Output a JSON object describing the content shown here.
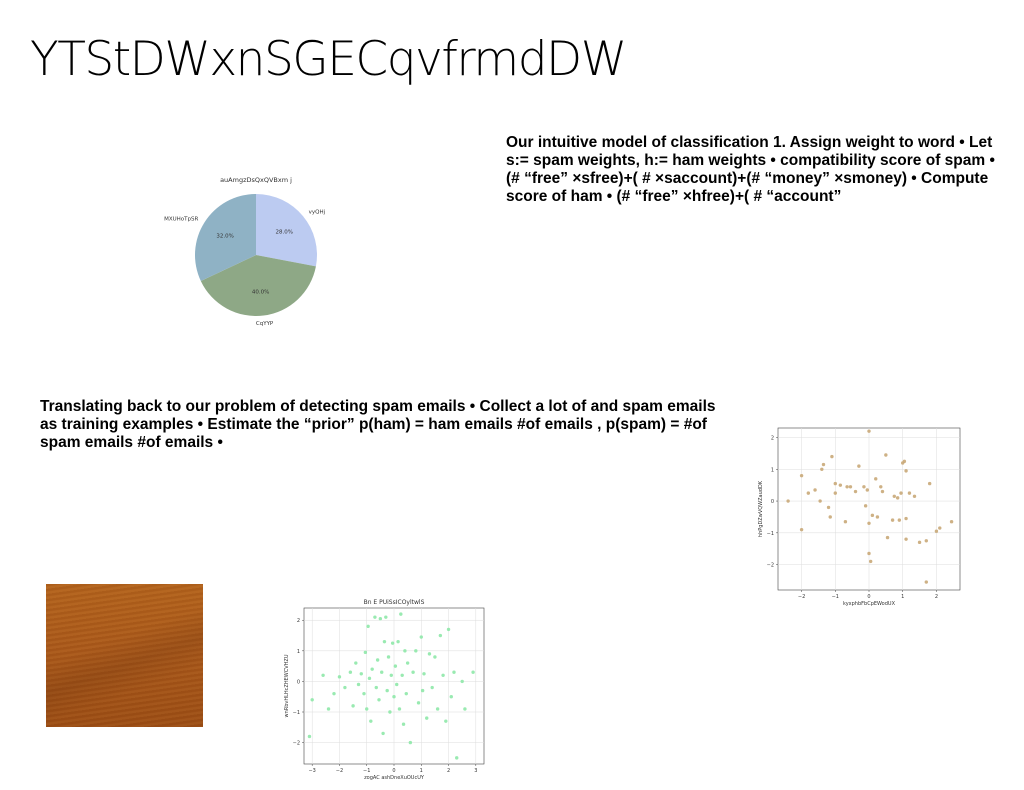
{
  "slide": {
    "title": "YTStDWxnSGECqvfrmdDW",
    "text_block_1": "Our intuitive model of classification 1. Assign weight to word • Let s:= spam weights, h:= ham weights • compatibility score of spam • (# “free” ×sfree)+( # ×saccount)+(# “money” ×smoney) • Compute score of ham • (# “free” ×hfree)+( # “account”",
    "text_block_2": "Translating back to our problem of detecting spam emails • Collect a lot of and spam emails as training examples • Estimate the “prior” p(ham) = ham emails #of emails , p(spam) = #of spam emails #of emails •",
    "image_description_icon": "wood-texture-image"
  },
  "chart_data": [
    {
      "type": "pie",
      "title": "auAmgzDsQxQVBxm j",
      "labels": [
        "vyQHj",
        "CqYYP",
        "MXUHoTpSR"
      ],
      "values": [
        28.0,
        40.0,
        32.0
      ],
      "pct_labels": [
        "28.0%",
        "40.0%",
        "32.0%"
      ],
      "colors": [
        "#bccbf1",
        "#8ea886",
        "#8fb2c5"
      ]
    },
    {
      "type": "scatter",
      "title": "",
      "xlabel": "kyxphbFbCpEWodUX",
      "ylabel": "hhPgDZwVQWZaudDK",
      "xlim": [
        -2.7,
        2.7
      ],
      "ylim": [
        -2.8,
        2.3
      ],
      "xticks": [
        -2,
        -1,
        0,
        1,
        2
      ],
      "yticks": [
        -2,
        -1,
        0,
        1,
        2
      ],
      "grid": true,
      "color": "#c9a978",
      "points": [
        [
          -2.4,
          0.0
        ],
        [
          -2.0,
          0.8
        ],
        [
          -2.0,
          -0.9
        ],
        [
          -1.8,
          0.25
        ],
        [
          -1.6,
          0.35
        ],
        [
          -1.45,
          0.0
        ],
        [
          -1.4,
          1.0
        ],
        [
          -1.35,
          1.15
        ],
        [
          -1.2,
          -0.2
        ],
        [
          -1.15,
          -0.5
        ],
        [
          -1.1,
          1.4
        ],
        [
          -1.0,
          0.25
        ],
        [
          -1.0,
          0.55
        ],
        [
          -0.85,
          0.5
        ],
        [
          -0.7,
          -0.65
        ],
        [
          -0.65,
          0.45
        ],
        [
          -0.55,
          0.45
        ],
        [
          -0.4,
          0.3
        ],
        [
          -0.3,
          1.1
        ],
        [
          -0.15,
          0.45
        ],
        [
          -0.1,
          -0.15
        ],
        [
          -0.05,
          0.35
        ],
        [
          0.0,
          2.2
        ],
        [
          0.0,
          -1.65
        ],
        [
          0.0,
          -0.7
        ],
        [
          0.05,
          -1.9
        ],
        [
          0.1,
          -0.45
        ],
        [
          0.2,
          0.7
        ],
        [
          0.25,
          -0.5
        ],
        [
          0.35,
          0.45
        ],
        [
          0.4,
          0.3
        ],
        [
          0.5,
          1.45
        ],
        [
          0.55,
          -1.15
        ],
        [
          0.7,
          -0.6
        ],
        [
          0.75,
          0.15
        ],
        [
          0.85,
          0.1
        ],
        [
          0.9,
          -0.6
        ],
        [
          0.95,
          0.25
        ],
        [
          1.0,
          1.2
        ],
        [
          1.05,
          1.25
        ],
        [
          1.1,
          0.95
        ],
        [
          1.1,
          -1.2
        ],
        [
          1.1,
          -0.55
        ],
        [
          1.2,
          0.25
        ],
        [
          1.35,
          0.15
        ],
        [
          1.5,
          -1.3
        ],
        [
          1.7,
          -2.55
        ],
        [
          1.7,
          -1.25
        ],
        [
          1.8,
          0.55
        ],
        [
          2.0,
          -0.95
        ],
        [
          2.1,
          -0.85
        ],
        [
          2.45,
          -0.65
        ]
      ]
    },
    {
      "type": "scatter",
      "title": "Bn E PUiSsICOyltwlS",
      "xlabel": "zogAC ashDneXuOUcUY",
      "ylabel": "wnRbvHLHcZHEWCVHZU",
      "xlim": [
        -3.3,
        3.3
      ],
      "ylim": [
        -2.7,
        2.4
      ],
      "xticks": [
        -3,
        -2,
        -1,
        0,
        1,
        2,
        3
      ],
      "yticks": [
        -2,
        -1,
        0,
        1,
        2
      ],
      "grid": true,
      "color": "#8ee8a8",
      "points": [
        [
          -3.1,
          -1.8
        ],
        [
          -3.0,
          -0.6
        ],
        [
          -2.6,
          0.2
        ],
        [
          -2.4,
          -0.9
        ],
        [
          -2.2,
          -0.4
        ],
        [
          -2.0,
          0.15
        ],
        [
          -1.8,
          -0.2
        ],
        [
          -1.6,
          0.3
        ],
        [
          -1.5,
          -0.8
        ],
        [
          -1.4,
          0.6
        ],
        [
          -1.3,
          -0.1
        ],
        [
          -1.2,
          0.25
        ],
        [
          -1.1,
          -0.4
        ],
        [
          -1.05,
          0.95
        ],
        [
          -1.0,
          -0.9
        ],
        [
          -0.95,
          1.8
        ],
        [
          -0.9,
          0.1
        ],
        [
          -0.85,
          -1.3
        ],
        [
          -0.8,
          0.4
        ],
        [
          -0.7,
          2.1
        ],
        [
          -0.65,
          -0.2
        ],
        [
          -0.6,
          0.7
        ],
        [
          -0.55,
          -0.6
        ],
        [
          -0.5,
          2.05
        ],
        [
          -0.45,
          0.3
        ],
        [
          -0.4,
          -1.7
        ],
        [
          -0.35,
          1.3
        ],
        [
          -0.3,
          2.1
        ],
        [
          -0.25,
          -0.3
        ],
        [
          -0.2,
          0.8
        ],
        [
          -0.15,
          -1.0
        ],
        [
          -0.1,
          0.2
        ],
        [
          -0.05,
          1.25
        ],
        [
          0.0,
          -0.5
        ],
        [
          0.05,
          0.5
        ],
        [
          0.1,
          -0.1
        ],
        [
          0.15,
          1.3
        ],
        [
          0.2,
          -0.9
        ],
        [
          0.25,
          2.2
        ],
        [
          0.3,
          0.2
        ],
        [
          0.35,
          -1.4
        ],
        [
          0.4,
          1.0
        ],
        [
          0.45,
          -0.4
        ],
        [
          0.5,
          0.6
        ],
        [
          0.6,
          -2.0
        ],
        [
          0.7,
          0.3
        ],
        [
          0.8,
          1.0
        ],
        [
          0.9,
          -0.7
        ],
        [
          1.0,
          1.45
        ],
        [
          1.05,
          -0.3
        ],
        [
          1.1,
          0.25
        ],
        [
          1.2,
          -1.2
        ],
        [
          1.3,
          0.9
        ],
        [
          1.4,
          -0.2
        ],
        [
          1.5,
          0.8
        ],
        [
          1.6,
          -0.9
        ],
        [
          1.7,
          1.5
        ],
        [
          1.8,
          0.2
        ],
        [
          1.9,
          -1.3
        ],
        [
          2.0,
          1.7
        ],
        [
          2.1,
          -0.5
        ],
        [
          2.2,
          0.3
        ],
        [
          2.3,
          -2.5
        ],
        [
          2.5,
          0.0
        ],
        [
          2.6,
          -0.9
        ],
        [
          2.9,
          0.3
        ]
      ]
    }
  ]
}
